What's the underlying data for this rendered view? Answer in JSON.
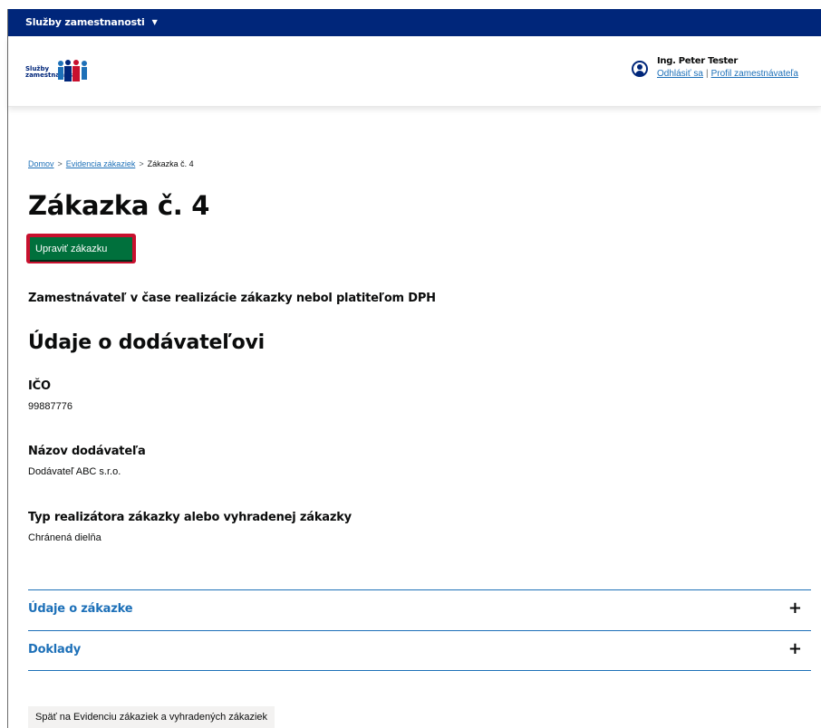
{
  "topbar": {
    "brand": "Služby zamestnanosti",
    "dropdown_icon": "caret-down-icon"
  },
  "header": {
    "logo_text_line1": "Služby",
    "logo_text_line2": "zamestnanosti",
    "user_name": "Ing. Peter Tester",
    "logout_label": "Odhlásiť sa",
    "link_separator": "|",
    "profile_label": "Profil zamestnávateľa",
    "user_icon": "user-circle-icon"
  },
  "breadcrumb": {
    "items": [
      "Domov",
      "Evidencia zákaziek",
      "Zákazka č. 4"
    ],
    "separator": ">"
  },
  "page": {
    "title": "Zákazka č. 4",
    "edit_button": "Upraviť zákazku",
    "dph_note": "Zamestnávateľ v čase realizácie zákazky nebol platiteľom DPH"
  },
  "supplier": {
    "section_title": "Údaje o dodávateľovi",
    "fields": [
      {
        "label": "IČO",
        "value": "99887776"
      },
      {
        "label": "Názov dodávateľa",
        "value": "Dodávateľ ABC s.r.o."
      },
      {
        "label": "Typ realizátora zákazky alebo vyhradenej zákazky",
        "value": "Chránená dielňa"
      }
    ]
  },
  "accordion": {
    "items": [
      {
        "title": "Údaje o zákazke",
        "icon": "+"
      },
      {
        "title": "Doklady",
        "icon": "+"
      }
    ]
  },
  "footer": {
    "back_button": "Späť na Evidenciu zákaziek a vyhradených zákaziek"
  },
  "colors": {
    "topbar": "#00267a",
    "link": "#1d70b8",
    "button_green": "#00703c",
    "highlight_red": "#c8102e"
  }
}
